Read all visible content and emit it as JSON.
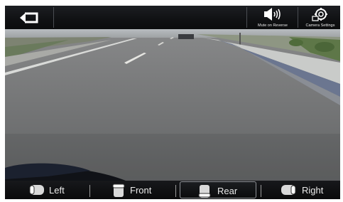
{
  "top_bar": {
    "back_icon": "return-arrow-icon",
    "mute_icon": "speaker-icon",
    "mute_label": "Mute on Reverse",
    "settings_icon": "camera-settings-icon",
    "settings_label": "Camera Settings"
  },
  "bottom_bar": {
    "views": [
      {
        "label": "Left",
        "icon": "left-camera-icon",
        "selected": false
      },
      {
        "label": "Front",
        "icon": "front-camera-icon",
        "selected": false
      },
      {
        "label": "Rear",
        "icon": "rear-camera-icon",
        "selected": true
      },
      {
        "label": "Right",
        "icon": "right-camera-icon",
        "selected": false
      }
    ]
  },
  "colors": {
    "bar_bg": "#101113",
    "text": "#eaeaea",
    "selected_border": "#8e9196"
  }
}
